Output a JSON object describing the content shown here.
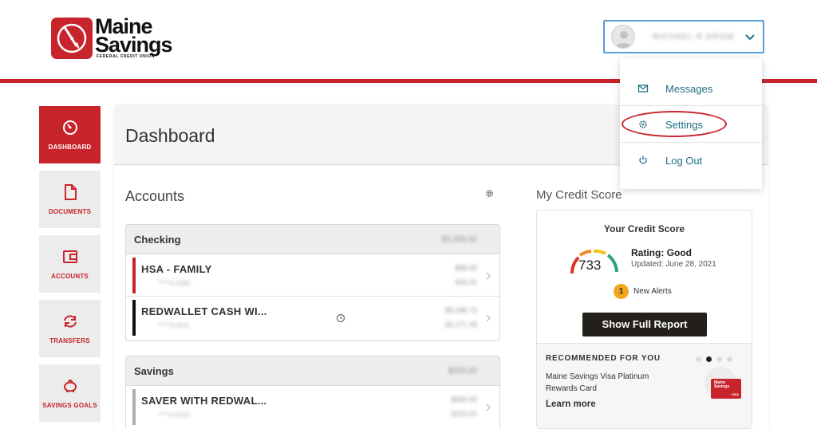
{
  "brand": {
    "line1": "Maine",
    "line2": "Savings",
    "line3": "FEDERAL CREDIT UNION"
  },
  "user": {
    "name": "MICHAEL R DROW"
  },
  "user_menu": {
    "items": [
      {
        "label": "Messages",
        "icon": "envelope-icon"
      },
      {
        "label": "Settings",
        "icon": "gear-icon"
      },
      {
        "label": "Log Out",
        "icon": "power-icon"
      }
    ]
  },
  "sidebar": {
    "items": [
      {
        "label": "DASHBOARD",
        "icon": "speedometer-icon",
        "active": true
      },
      {
        "label": "DOCUMENTS",
        "icon": "document-icon"
      },
      {
        "label": "ACCOUNTS",
        "icon": "wallet-icon"
      },
      {
        "label": "TRANSFERS",
        "icon": "transfer-arrows-icon"
      },
      {
        "label": "SAVINGS GOALS",
        "icon": "piggy-bank-icon"
      }
    ]
  },
  "main": {
    "title": "Dashboard"
  },
  "accounts": {
    "title": "Accounts",
    "groups": [
      {
        "name": "Checking",
        "total": "$3,265.52",
        "rows": [
          {
            "name": "HSA - FAMILY",
            "sub": "*****0-0000",
            "v1": "$95.00",
            "v2": "$95.00",
            "color": "#c8242b"
          },
          {
            "name": "REDWALLET CASH WI...",
            "sub": "*****0-0011",
            "v1": "$3,196.72",
            "v2": "$3,171.48",
            "color": "#111111"
          }
        ]
      },
      {
        "name": "Savings",
        "total": "$250.00",
        "rows": [
          {
            "name": "SAVER WITH REDWAL...",
            "sub": "*****0-0021",
            "v1": "$250.00",
            "v2": "$250.00",
            "color": "#b5aca3"
          }
        ]
      }
    ]
  },
  "credit": {
    "section_title": "My Credit Score",
    "card_title": "Your Credit Score",
    "score": "733",
    "rating": "Rating: Good",
    "updated": "Updated: June 28, 2021",
    "alerts_count": "1",
    "alerts_label": "New Alerts",
    "button": "Show Full Report",
    "recommended_title": "RECOMMENDED FOR YOU",
    "recommended_name": "Maine Savings Visa Platinum Rewards Card",
    "learn_more": "Learn more",
    "mini_card_brand": "Maine Savings",
    "mini_card_network": "VISA",
    "gauge_fraction": 0.72
  },
  "colors": {
    "brand_red": "#c8242b",
    "link_teal": "#1f6f86",
    "button_dark": "#231f1b",
    "alert_orange": "#f0a61b"
  }
}
